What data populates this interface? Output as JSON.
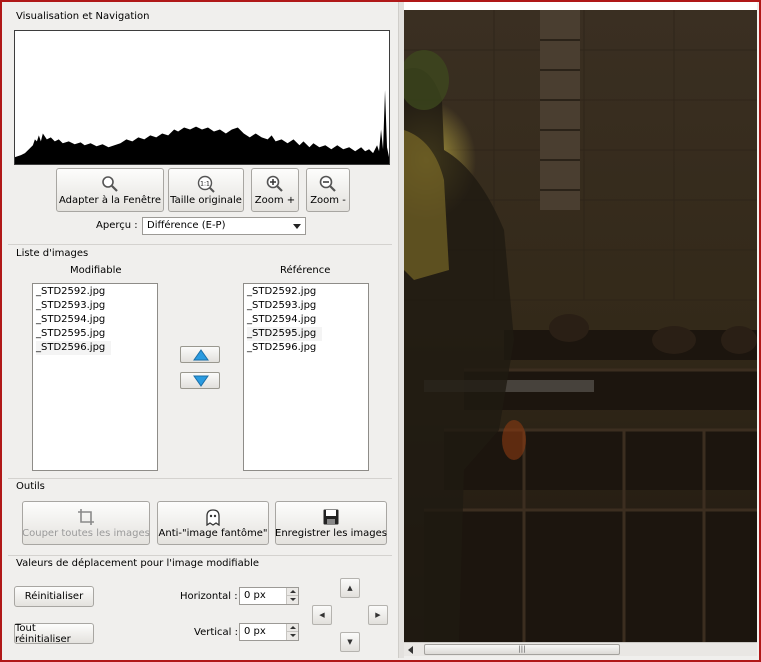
{
  "navigation": {
    "group_title": "Visualisation et Navigation",
    "buttons": {
      "fit": "Adapter à la Fenêtre",
      "original": "Taille originale",
      "zoom_in": "Zoom +",
      "zoom_out": "Zoom -"
    },
    "original_icon_text": "1:1",
    "preview_label": "Aperçu :",
    "preview_value": "Différence (E-P)"
  },
  "images": {
    "group_title": "Liste d'images",
    "modifiable_header": "Modifiable",
    "reference_header": "Référence",
    "modifiable_items": [
      "_STD2592.jpg",
      "_STD2593.jpg",
      "_STD2594.jpg",
      "_STD2595.jpg",
      "_STD2596.jpg"
    ],
    "reference_items": [
      "_STD2592.jpg",
      "_STD2593.jpg",
      "_STD2594.jpg",
      "_STD2595.jpg",
      "_STD2596.jpg"
    ]
  },
  "tools": {
    "group_title": "Outils",
    "crop_label": "Couper toutes les images",
    "ghost_label": "Anti-\"image fantôme\"",
    "save_label": "Enregistrer les images"
  },
  "offset": {
    "group_title": "Valeurs de déplacement pour l'image modifiable",
    "reset_label": "Réinitialiser",
    "reset_all_label": "Tout réinitialiser",
    "horizontal_label": "Horizontal :",
    "horizontal_value": "0 px",
    "vertical_label": "Vertical :",
    "vertical_value": "0 px"
  },
  "colors": {
    "window_border": "#b01818",
    "panel_bg": "#f0efed",
    "arrow_blue": "#2a9be0"
  }
}
